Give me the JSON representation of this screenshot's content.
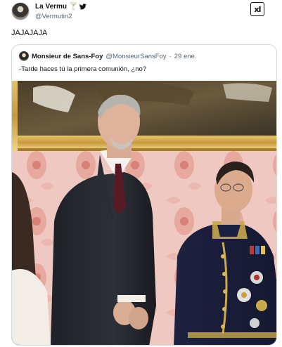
{
  "tweet": {
    "author": {
      "display_name": "La Vermu",
      "handle": "@Vermutin2",
      "icons": [
        "cocktail-icon",
        "bird-icon"
      ]
    },
    "grok_label": "xI",
    "text": "JAJAJAJA"
  },
  "quoted_tweet": {
    "author": {
      "display_name": "Monsieur de Sans-Foy",
      "handle": "@MonsieurSansFoy",
      "separator": "·",
      "date": "29 ene."
    },
    "text": "-Tarde haces tú la primera comunión, ¿no?",
    "media": {
      "type": "photo"
    }
  },
  "colors": {
    "text_primary": "#0f1419",
    "text_secondary": "#536471",
    "border": "#cfd9de",
    "twitter_blue": "#1d9bf0"
  }
}
